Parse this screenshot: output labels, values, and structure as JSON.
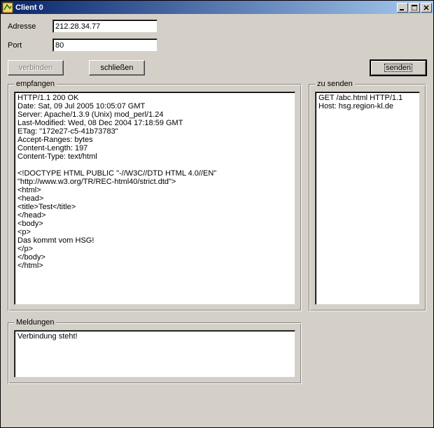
{
  "window": {
    "title": "Client 0"
  },
  "form": {
    "adresse_label": "Adresse",
    "adresse_value": "212.28.34.77",
    "port_label": "Port",
    "port_value": "80"
  },
  "buttons": {
    "verbinden": "verbinden",
    "schliessen": "schließen",
    "senden": "senden"
  },
  "panels": {
    "empfangen_label": "empfangen",
    "empfangen_text": "HTTP/1.1 200 OK\nDate: Sat, 09 Jul 2005 10:05:07 GMT\nServer: Apache/1.3.9 (Unix) mod_perl/1.24\nLast-Modified: Wed, 08 Dec 2004 17:18:59 GMT\nETag: \"172e27-c5-41b73783\"\nAccept-Ranges: bytes\nContent-Length: 197\nContent-Type: text/html\n\n<!DOCTYPE HTML PUBLIC \"-//W3C//DTD HTML 4.0//EN\"\n\"http://www.w3.org/TR/REC-html40/strict.dtd\">\n<html>\n<head>\n<title>Test</title>\n</head>\n<body>\n<p>\nDas kommt vom HSG!\n</p>\n</body>\n</html>",
    "senden_label": "zu senden",
    "senden_text": "GET /abc.html HTTP/1.1\nHost: hsg.region-kl.de",
    "meldungen_label": "Meldungen",
    "meldungen_text": "Verbindung steht!"
  }
}
